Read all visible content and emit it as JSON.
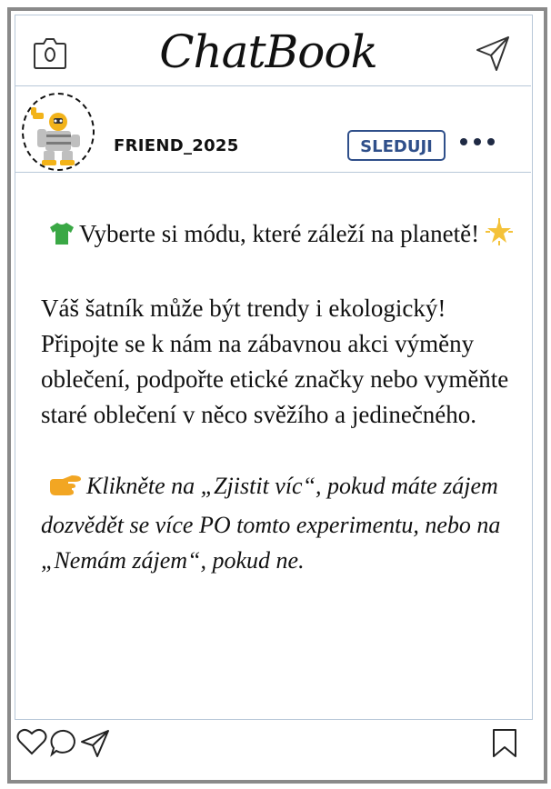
{
  "app": {
    "title": "ChatBook"
  },
  "post": {
    "username": "FRIEND_2025",
    "follow_label": "SLEDUJI",
    "headline": "Vyberte si módu, které záleží na planetě!",
    "body": "Váš šatník může být trendy i ekologický! Připojte se k nám na zábavnou akci výměny oblečení, podpořte etické značky nebo vyměňte staré oblečení v něco svěžího a jedinečného.",
    "cta": "Klikněte na „Zjistit víc“, pokud máte zájem dozvědět se více PO tomto experimentu, nebo na „Nemám zájem“, pokud ne."
  },
  "icons": {
    "header_left": "camera-icon",
    "header_right": "send-icon",
    "headline_prefix": "tshirt-icon",
    "headline_suffix": "sparkle-star-icon",
    "cta_prefix": "pointing-hand-icon",
    "footer": [
      "heart-icon",
      "comment-icon",
      "share-icon",
      "bookmark-icon"
    ]
  },
  "colors": {
    "frame": "#8a8a8a",
    "divider": "#b8c8d8",
    "follow_accent": "#2f4f8a",
    "tshirt": "#3aa845",
    "star": "#f4c23a",
    "hand": "#f2a623"
  }
}
